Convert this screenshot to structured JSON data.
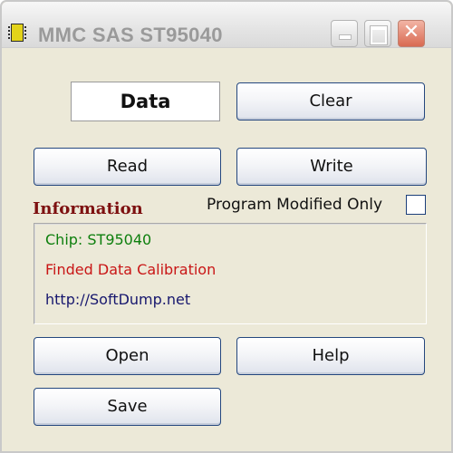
{
  "window": {
    "title": "MMC SAS ST95040",
    "close_glyph": "✕"
  },
  "data_field": {
    "label": "Data"
  },
  "buttons": {
    "clear": "Clear",
    "read": "Read",
    "write": "Write",
    "open": "Open",
    "help": "Help",
    "save": "Save"
  },
  "information": {
    "heading": "Information",
    "lines": [
      {
        "text": "Chip: ST95040",
        "color": "#0d7f0d"
      },
      {
        "text": "Finded Data Calibration",
        "color": "#c91616"
      },
      {
        "text": "http://SoftDump.net",
        "color": "#17176e"
      }
    ]
  },
  "options": {
    "program_modified_only_label": "Program Modified Only",
    "program_modified_only_checked": false
  },
  "icons": {
    "app": "chip-icon",
    "minimize": "minimize-icon",
    "maximize": "maximize-icon",
    "close": "close-icon"
  },
  "colors": {
    "window_bg": "#ece9d8",
    "info_heading": "#7d1010",
    "button_border": "#24477e"
  }
}
